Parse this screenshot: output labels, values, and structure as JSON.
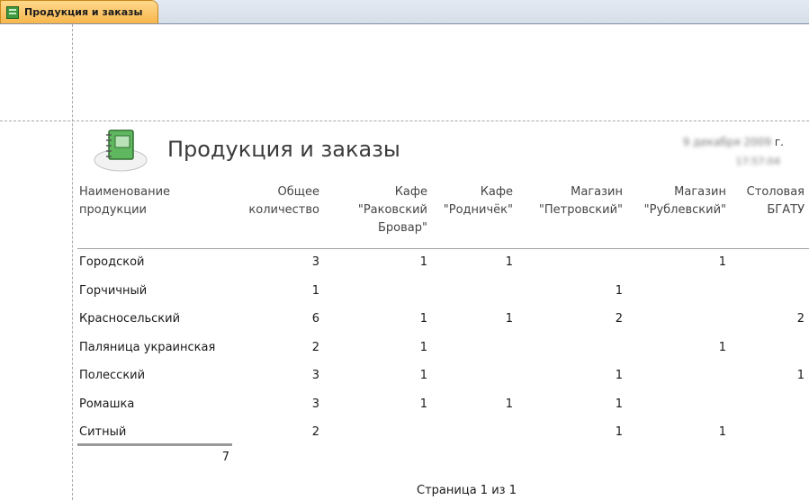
{
  "tab": {
    "label": "Продукция и заказы",
    "icon": "report-icon"
  },
  "report": {
    "title": "Продукция и заказы",
    "logo_icon": "notebook-icon",
    "date_blurred": "9 декабря 2009",
    "date_suffix": "г.",
    "time_blurred": "17:57:04"
  },
  "columns": [
    {
      "line1": "Наименование",
      "line2": "продукции",
      "line3": ""
    },
    {
      "line1": "Общее",
      "line2": "количество",
      "line3": ""
    },
    {
      "line1": "Кафе",
      "line2": "\"Раковский",
      "line3": "Бровар\""
    },
    {
      "line1": "Кафе",
      "line2": "\"Родничёк\"",
      "line3": ""
    },
    {
      "line1": "Магазин",
      "line2": "\"Петровский\"",
      "line3": ""
    },
    {
      "line1": "Магазин",
      "line2": "\"Рублевский\"",
      "line3": ""
    },
    {
      "line1": "Столовая",
      "line2": "БГАТУ",
      "line3": ""
    }
  ],
  "rows": [
    {
      "name": "Городской",
      "values": [
        "3",
        "1",
        "1",
        "",
        "1",
        ""
      ]
    },
    {
      "name": "Горчичный",
      "values": [
        "1",
        "",
        "",
        "1",
        "",
        ""
      ]
    },
    {
      "name": "Красносельский",
      "values": [
        "6",
        "1",
        "1",
        "2",
        "",
        "2"
      ]
    },
    {
      "name": "Паляница украинская",
      "values": [
        "2",
        "1",
        "",
        "",
        "1",
        ""
      ]
    },
    {
      "name": "Полесский",
      "values": [
        "3",
        "1",
        "",
        "1",
        "",
        "1"
      ]
    },
    {
      "name": "Ромашка",
      "values": [
        "3",
        "1",
        "1",
        "1",
        "",
        ""
      ]
    },
    {
      "name": "Ситный",
      "values": [
        "2",
        "",
        "",
        "1",
        "1",
        ""
      ]
    }
  ],
  "total": "7",
  "footer": "Страница 1 из 1"
}
